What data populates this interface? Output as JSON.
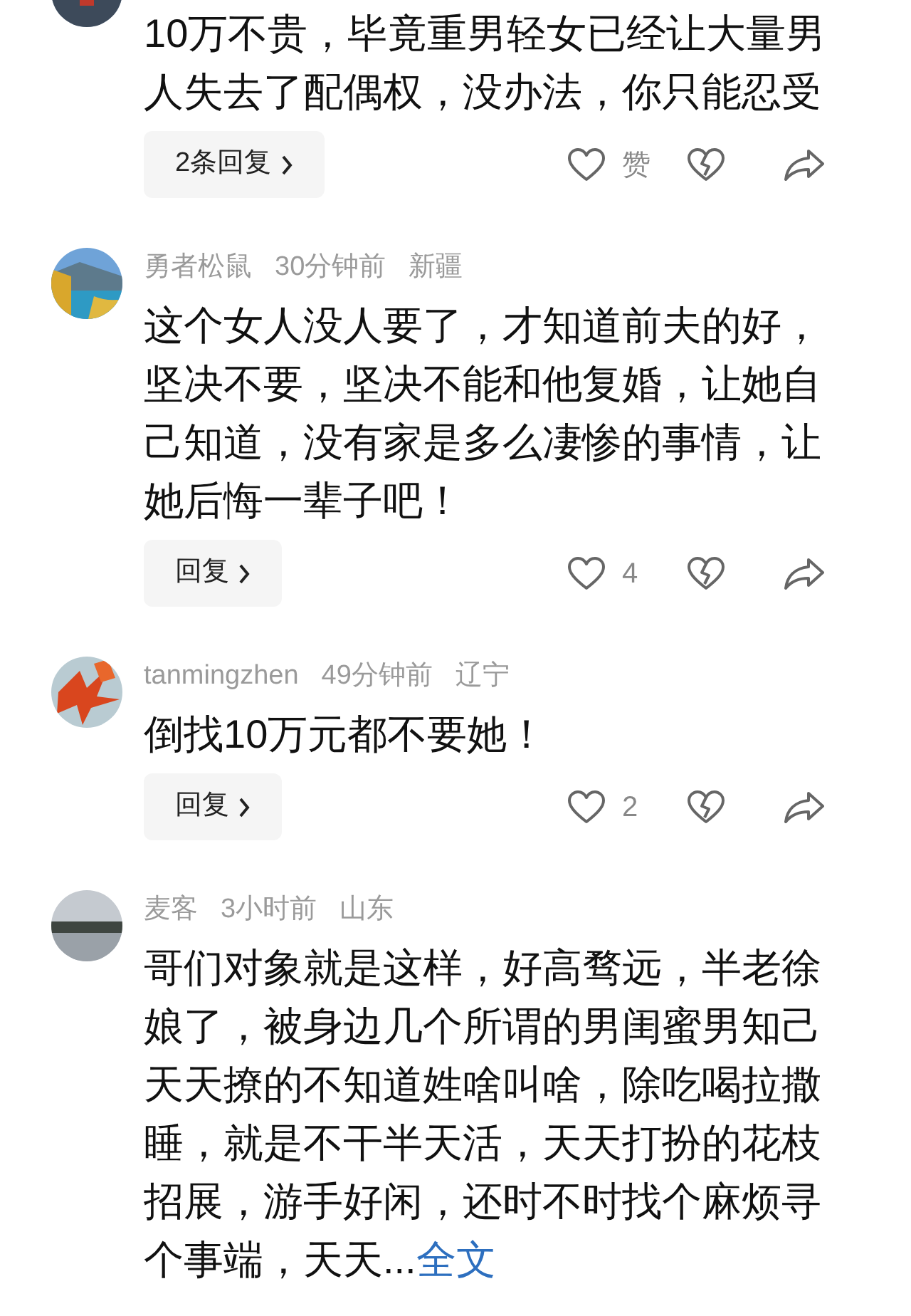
{
  "comments": [
    {
      "text": "10万不贵，毕竟重男轻女已经让大量男人失去了配偶权，没办法，你只能忍受",
      "reply_button": "2条回复",
      "like_count": "赞"
    },
    {
      "user": "勇者松鼠",
      "time": "30分钟前",
      "location": "新疆",
      "text": "这个女人没人要了，才知道前夫的好，坚决不要，坚决不能和他复婚，让她自己知道，没有家是多么凄惨的事情，让她后悔一辈子吧！",
      "reply_button": "回复",
      "like_count": "4"
    },
    {
      "user": "tanmingzhen",
      "time": "49分钟前",
      "location": "辽宁",
      "text": "倒找10万元都不要她！",
      "reply_button": "回复",
      "like_count": "2"
    },
    {
      "user": "麦客",
      "time": "3小时前",
      "location": "山东",
      "text": "哥们对象就是这样，好高骛远，半老徐娘了，被身边几个所谓的男闺蜜男知己天天撩的不知道姓啥叫啥，除吃喝拉撒睡，就是不干半天活，天天打扮的花枝招展，游手好闲，还时不时找个麻烦寻个事端，天天...",
      "more_link": "全文"
    }
  ]
}
